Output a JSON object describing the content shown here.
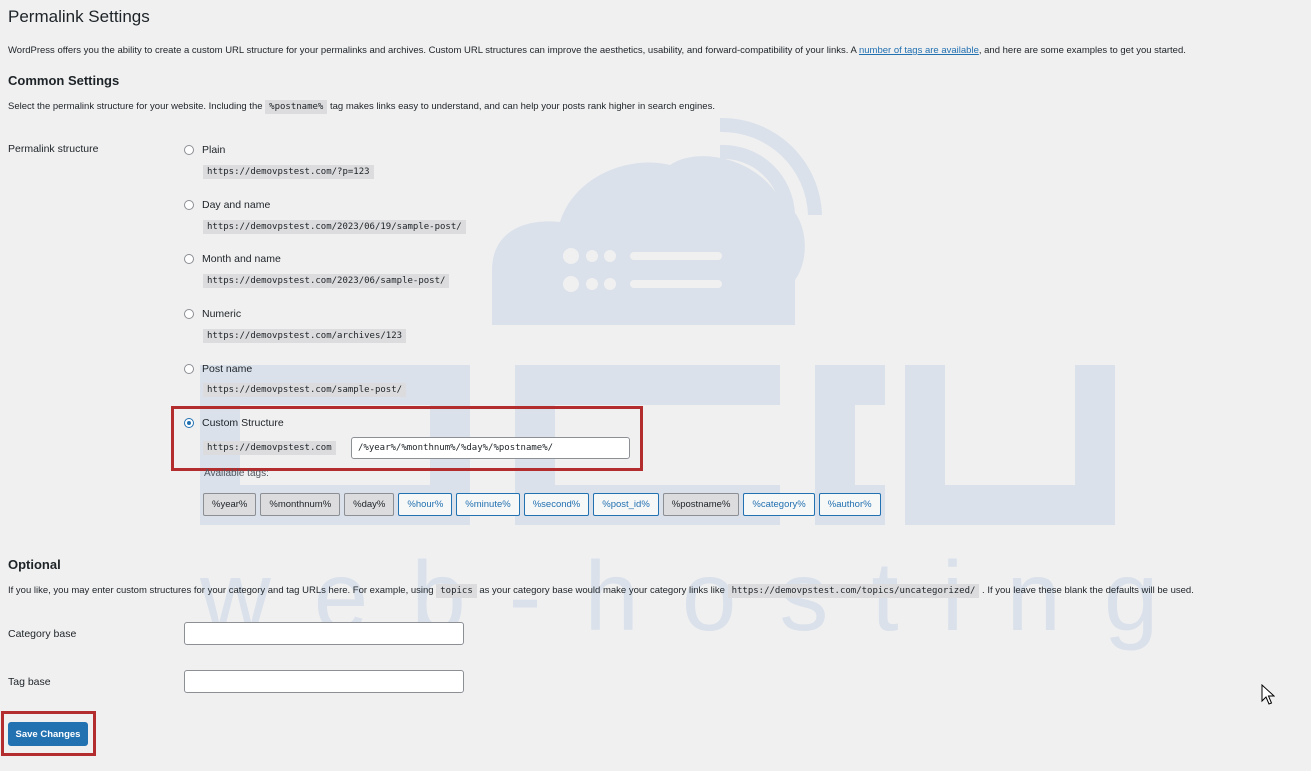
{
  "page": {
    "title": "Permalink Settings"
  },
  "intro": {
    "text_before": "WordPress offers you the ability to create a custom URL structure for your permalinks and archives. Custom URL structures can improve the aesthetics, usability, and forward-compatibility of your links. A ",
    "link": "number of tags are available",
    "text_after": ", and here are some examples to get you started."
  },
  "common": {
    "heading": "Common Settings",
    "desc_before": "Select the permalink structure for your website. Including the ",
    "desc_code": "%postname%",
    "desc_after": " tag makes links easy to understand, and can help your posts rank higher in search engines.",
    "row_label": "Permalink structure",
    "options": [
      {
        "label": "Plain",
        "example": "https://demovpstest.com/?p=123",
        "checked": false
      },
      {
        "label": "Day and name",
        "example": "https://demovpstest.com/2023/06/19/sample-post/",
        "checked": false
      },
      {
        "label": "Month and name",
        "example": "https://demovpstest.com/2023/06/sample-post/",
        "checked": false
      },
      {
        "label": "Numeric",
        "example": "https://demovpstest.com/archives/123",
        "checked": false
      },
      {
        "label": "Post name",
        "example": "https://demovpstest.com/sample-post/",
        "checked": false
      },
      {
        "label": "Custom Structure",
        "example": "https://demovpstest.com",
        "checked": true
      }
    ],
    "custom_value": "/%year%/%monthnum%/%day%/%postname%/",
    "available_tags_label": "Available tags:",
    "tags": [
      {
        "label": "%year%",
        "active": true
      },
      {
        "label": "%monthnum%",
        "active": true
      },
      {
        "label": "%day%",
        "active": true
      },
      {
        "label": "%hour%",
        "active": false
      },
      {
        "label": "%minute%",
        "active": false
      },
      {
        "label": "%second%",
        "active": false
      },
      {
        "label": "%post_id%",
        "active": false
      },
      {
        "label": "%postname%",
        "active": true
      },
      {
        "label": "%category%",
        "active": false
      },
      {
        "label": "%author%",
        "active": false
      }
    ]
  },
  "optional": {
    "heading": "Optional",
    "desc_before": "If you like, you may enter custom structures for your category and tag URLs here. For example, using ",
    "desc_code1": "topics",
    "desc_mid": " as your category base would make your category links like ",
    "desc_code2": "https://demovpstest.com/topics/uncategorized/",
    "desc_after": " . If you leave these blank the defaults will be used.",
    "category_label": "Category base",
    "category_value": "",
    "tag_label": "Tag base",
    "tag_value": ""
  },
  "save_label": "Save Changes",
  "watermark": {
    "text": "web-hosting"
  },
  "colors": {
    "accent": "#2271b1",
    "highlight": "#b32d2e",
    "background": "#f0f0f1"
  }
}
